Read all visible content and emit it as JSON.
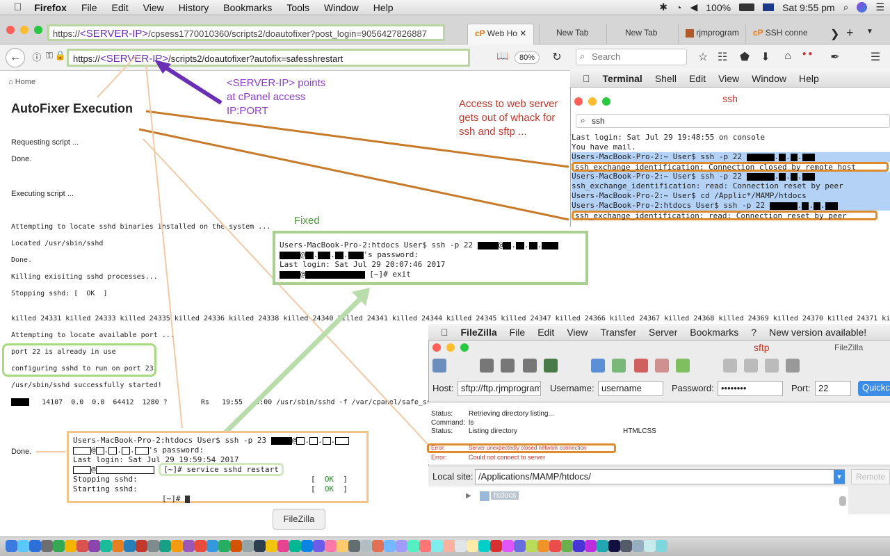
{
  "menubar": {
    "app": "Firefox",
    "items": [
      "File",
      "Edit",
      "View",
      "History",
      "Bookmarks",
      "Tools",
      "Window",
      "Help"
    ],
    "battery": "100%",
    "clock": "Sat 9:55 pm"
  },
  "browser": {
    "tabs": [
      "Web Ho",
      "New Tab",
      "New Tab",
      "rjmprogram",
      "SSH conne"
    ],
    "overlay_url_prefix": "https://",
    "overlay_url_ip": "<SERVER-IP>",
    "overlay_url_rest": "/cpsess1770010360/scripts2/doautofixer?post_login=9056427826887",
    "url_prefix": "https://",
    "url_ip": "<SERVER-IP>",
    "url_rest": "/scripts2/doautofixer?autofix=safesshrestart",
    "zoom": "80%",
    "search_placeholder": "Search"
  },
  "page": {
    "home": "Home",
    "title": "AutoFixer Execution",
    "lines": {
      "requesting": "Requesting script ...",
      "done1": "Done.",
      "executing": "Executing script ...",
      "locate_bin": "Attempting to locate sshd binaries installed on the system ...",
      "located": "Located /usr/sbin/sshd",
      "done2": "Done.",
      "killing": "Killing exisiting sshd processes...",
      "stopping": "Stopping sshd: [  OK  ]",
      "killed": "killed 24331 killed 24333 killed 24335 killed 24336 killed 24338 killed 24340 killed 24341 killed 24344 killed 24345 killed 24347 killed 24366 killed 24367 killed 24368 killed 24369 killed 24370 killed 24371 killed 2437",
      "locate_port": "Attempting to locate available port ...",
      "port_in_use": "port 22 is already in use",
      "configuring": "configuring sshd to run on port 23",
      "started": "/usr/sbin/sshd successfully started!",
      "ps": "14107  0.0  0.0  64412  1280 ?        Rs   19:55   0:00 /usr/sbin/sshd -f /var/cpanel/safe_sshd",
      "done3": "Done."
    }
  },
  "annotations": {
    "server_ip_note": [
      "<SERVER-IP> points",
      "at cPanel access",
      "IP:PORT"
    ],
    "access_note": [
      "Access to web server",
      "gets out of whack for",
      "ssh and sftp ..."
    ],
    "fixed": "Fixed"
  },
  "terminal": {
    "menu_app": "Terminal",
    "menu_items": [
      "Shell",
      "Edit",
      "View",
      "Window",
      "Help"
    ],
    "title": "ssh",
    "search_value": "ssh",
    "lines": [
      "Last login: Sat Jul 29 19:48:55 on console",
      "You have mail.",
      "Users-MacBook-Pro-2:~ User$ ssh -p 22",
      "ssh_exchange_identification: Connection closed by remote host",
      "Users-MacBook-Pro-2:~ User$ ssh -p 22",
      "ssh_exchange_identification: read: Connection reset by peer",
      "Users-MacBook-Pro-2:~ User$ cd /Applic*/MAMP/htdocs",
      "Users-MacBook-Pro-2:htdocs User$ ssh -p 22",
      "ssh_exchange_identification: read: Connection reset by peer"
    ]
  },
  "fixed_box": {
    "line1": "Users-MacBook-Pro-2:htdocs User$ ssh -p 22",
    "line2": "'s password:",
    "line3": "Last login: Sat Jul 29 20:07:46 2017",
    "line4": "[~]# exit"
  },
  "restart_box": {
    "line1": "Users-MacBook-Pro-2:htdocs User$ ssh -p 23",
    "line2": "'s password:",
    "line3": "Last login: Sat Jul 29 19:59:54 2017",
    "line4": "[~]# service sshd restart",
    "line5": "Stopping sshd:",
    "line6": "Starting sshd:",
    "ok_open": "[",
    "ok": "OK",
    "ok_close": "]",
    "line7": "[~]#"
  },
  "filezilla": {
    "menu_app": "FileZilla",
    "menu_items": [
      "File",
      "Edit",
      "View",
      "Transfer",
      "Server",
      "Bookmarks",
      "?",
      "New version available!"
    ],
    "window_title": "sftp",
    "window_app": "FileZilla",
    "host_label": "Host:",
    "host_value": "sftp://ftp.rjmprogram",
    "username_label": "Username:",
    "username_value": "username",
    "password_label": "Password:",
    "password_value": "••••••••",
    "port_label": "Port:",
    "port_value": "22",
    "quickconnect": "Quickc",
    "log": [
      {
        "label": "Status:",
        "text": "Retrieving directory listing..."
      },
      {
        "label": "Command:",
        "text": "ls"
      },
      {
        "label": "Status:",
        "text": "Listing directory"
      },
      {
        "label": "Error:",
        "text": "Server unexpectedly closed network connection"
      },
      {
        "label": "Error:",
        "text": "Could not connect to server"
      }
    ],
    "log_extra": "HTMLCSS",
    "local_site_label": "Local site:",
    "local_site_value": "/Applications/MAMP/htdocs/",
    "remote_label": "Remote",
    "tree_item": "htdocs"
  },
  "dock": {
    "tooltip": "FileZilla"
  }
}
